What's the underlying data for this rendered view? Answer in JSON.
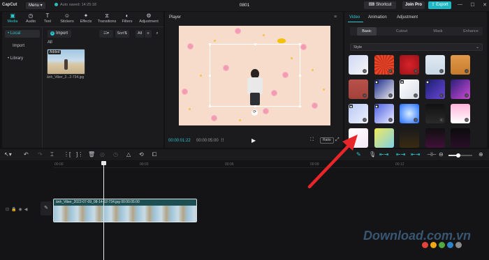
{
  "titlebar": {
    "app": "CapCut",
    "menu": "Menu",
    "autosave": "Auto saved: 14:25:18",
    "project": "0801",
    "shortcut": "Shortcut",
    "join_pro": "Join Pro",
    "export": "Export"
  },
  "media": {
    "tabs": [
      {
        "label": "Media",
        "icon": "media-icon"
      },
      {
        "label": "Audio",
        "icon": "audio-icon"
      },
      {
        "label": "Text",
        "icon": "text-icon"
      },
      {
        "label": "Stickers",
        "icon": "stickers-icon"
      },
      {
        "label": "Effects",
        "icon": "effects-icon"
      },
      {
        "label": "Transitions",
        "icon": "transitions-icon"
      },
      {
        "label": "Filters",
        "icon": "filters-icon"
      },
      {
        "label": "Adjustment",
        "icon": "adjustment-icon"
      }
    ],
    "sidebar": [
      {
        "label": "• Local"
      },
      {
        "label": "Import"
      },
      {
        "label": "• Library"
      }
    ],
    "import_label": "Import",
    "sort_label": "Sort",
    "all_filter": "All",
    "all_heading": "All",
    "item": {
      "badge": "Added",
      "caption": "ảnh_Viber_2...2-734.jpg"
    }
  },
  "player": {
    "title": "Player",
    "current_time": "00:00:01:22",
    "total_time": "00:00:05:00",
    "ratio": "Ratio"
  },
  "inspector": {
    "tabs": [
      "Video",
      "Animation",
      "Adjustment"
    ],
    "subtabs": [
      "Basic",
      "Cutout",
      "Mask",
      "Enhance"
    ],
    "style_select": "Style",
    "accent": "#2cc7d0"
  },
  "timeline": {
    "ticks": [
      "00:00",
      "00:03",
      "00:06",
      "00:09",
      "00:12"
    ],
    "clip_label": "ảnh_Viber_2022-07-09_08-14-52-734.jpg   00:00:05:00"
  },
  "watermark": {
    "text": "Download.com.vn"
  }
}
